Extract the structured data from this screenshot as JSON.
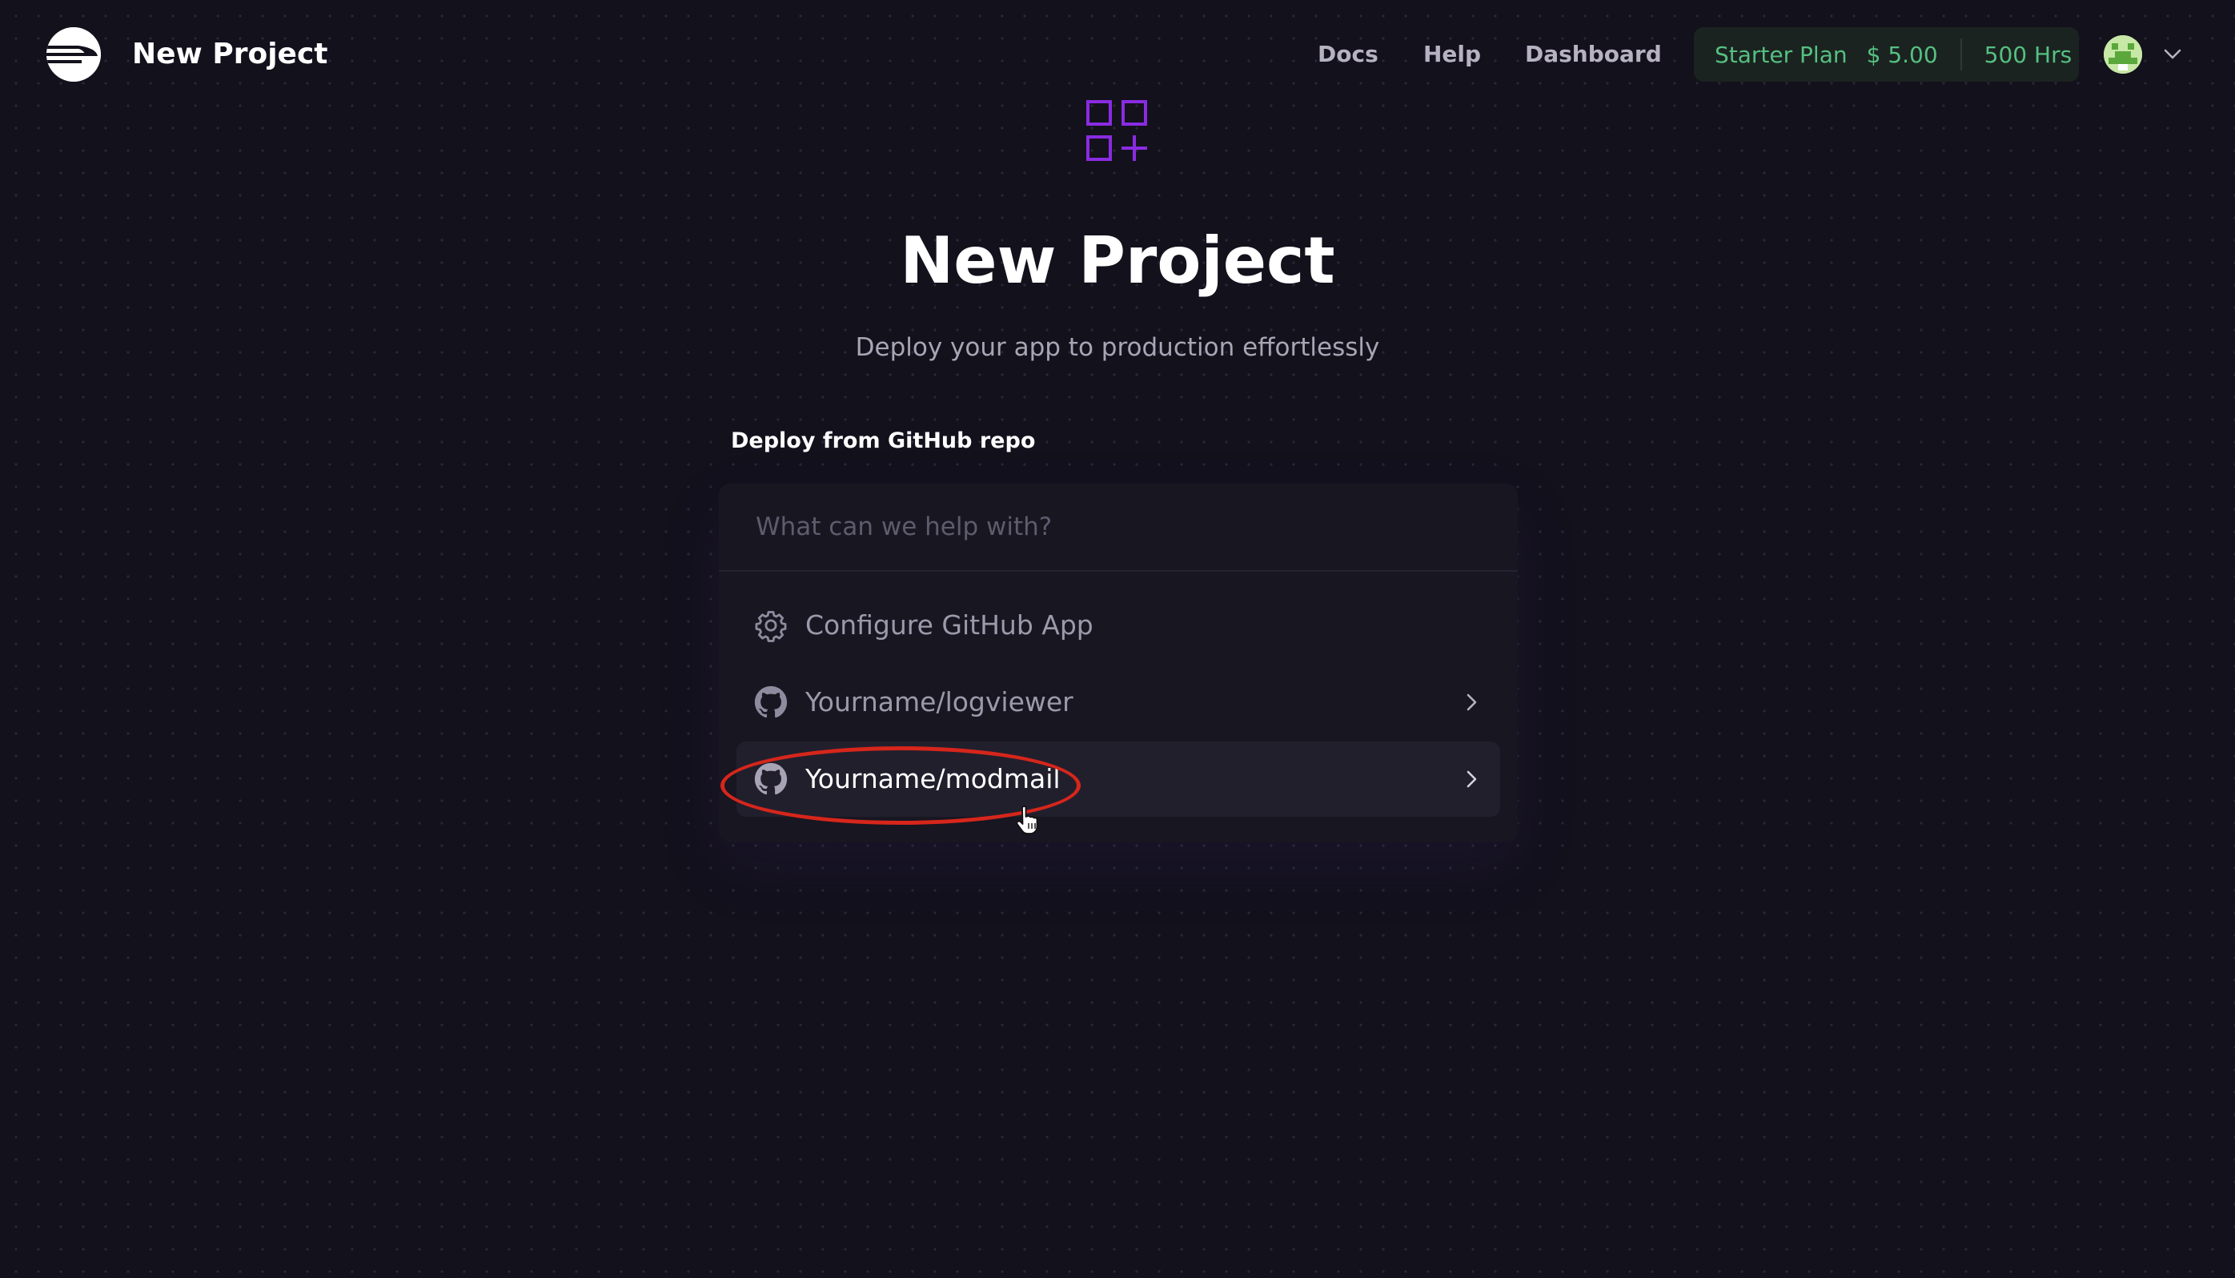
{
  "header": {
    "app_title": "New Project",
    "nav": [
      {
        "label": "Docs"
      },
      {
        "label": "Help"
      },
      {
        "label": "Dashboard"
      }
    ],
    "plan": {
      "name": "Starter Plan",
      "cost": "$ 5.00",
      "hours": "500 Hrs"
    }
  },
  "hero": {
    "icon": "grid-plus-icon",
    "title": "New Project",
    "subtitle": "Deploy your app to production effortlessly"
  },
  "deploy": {
    "section_label": "Deploy from GitHub repo",
    "search_placeholder": "What can we help with?",
    "search_value": "",
    "items": [
      {
        "label": "Configure GitHub App",
        "icon": "gear-icon"
      },
      {
        "label": "Yourname/logviewer",
        "icon": "github-icon"
      },
      {
        "label": "Yourname/modmail",
        "icon": "github-icon"
      }
    ]
  },
  "colors": {
    "background": "#13111c",
    "panel": "#181621",
    "accent_purple": "#8a2be2",
    "plan_green": "#55c081",
    "annotation_red": "#d7261b"
  }
}
